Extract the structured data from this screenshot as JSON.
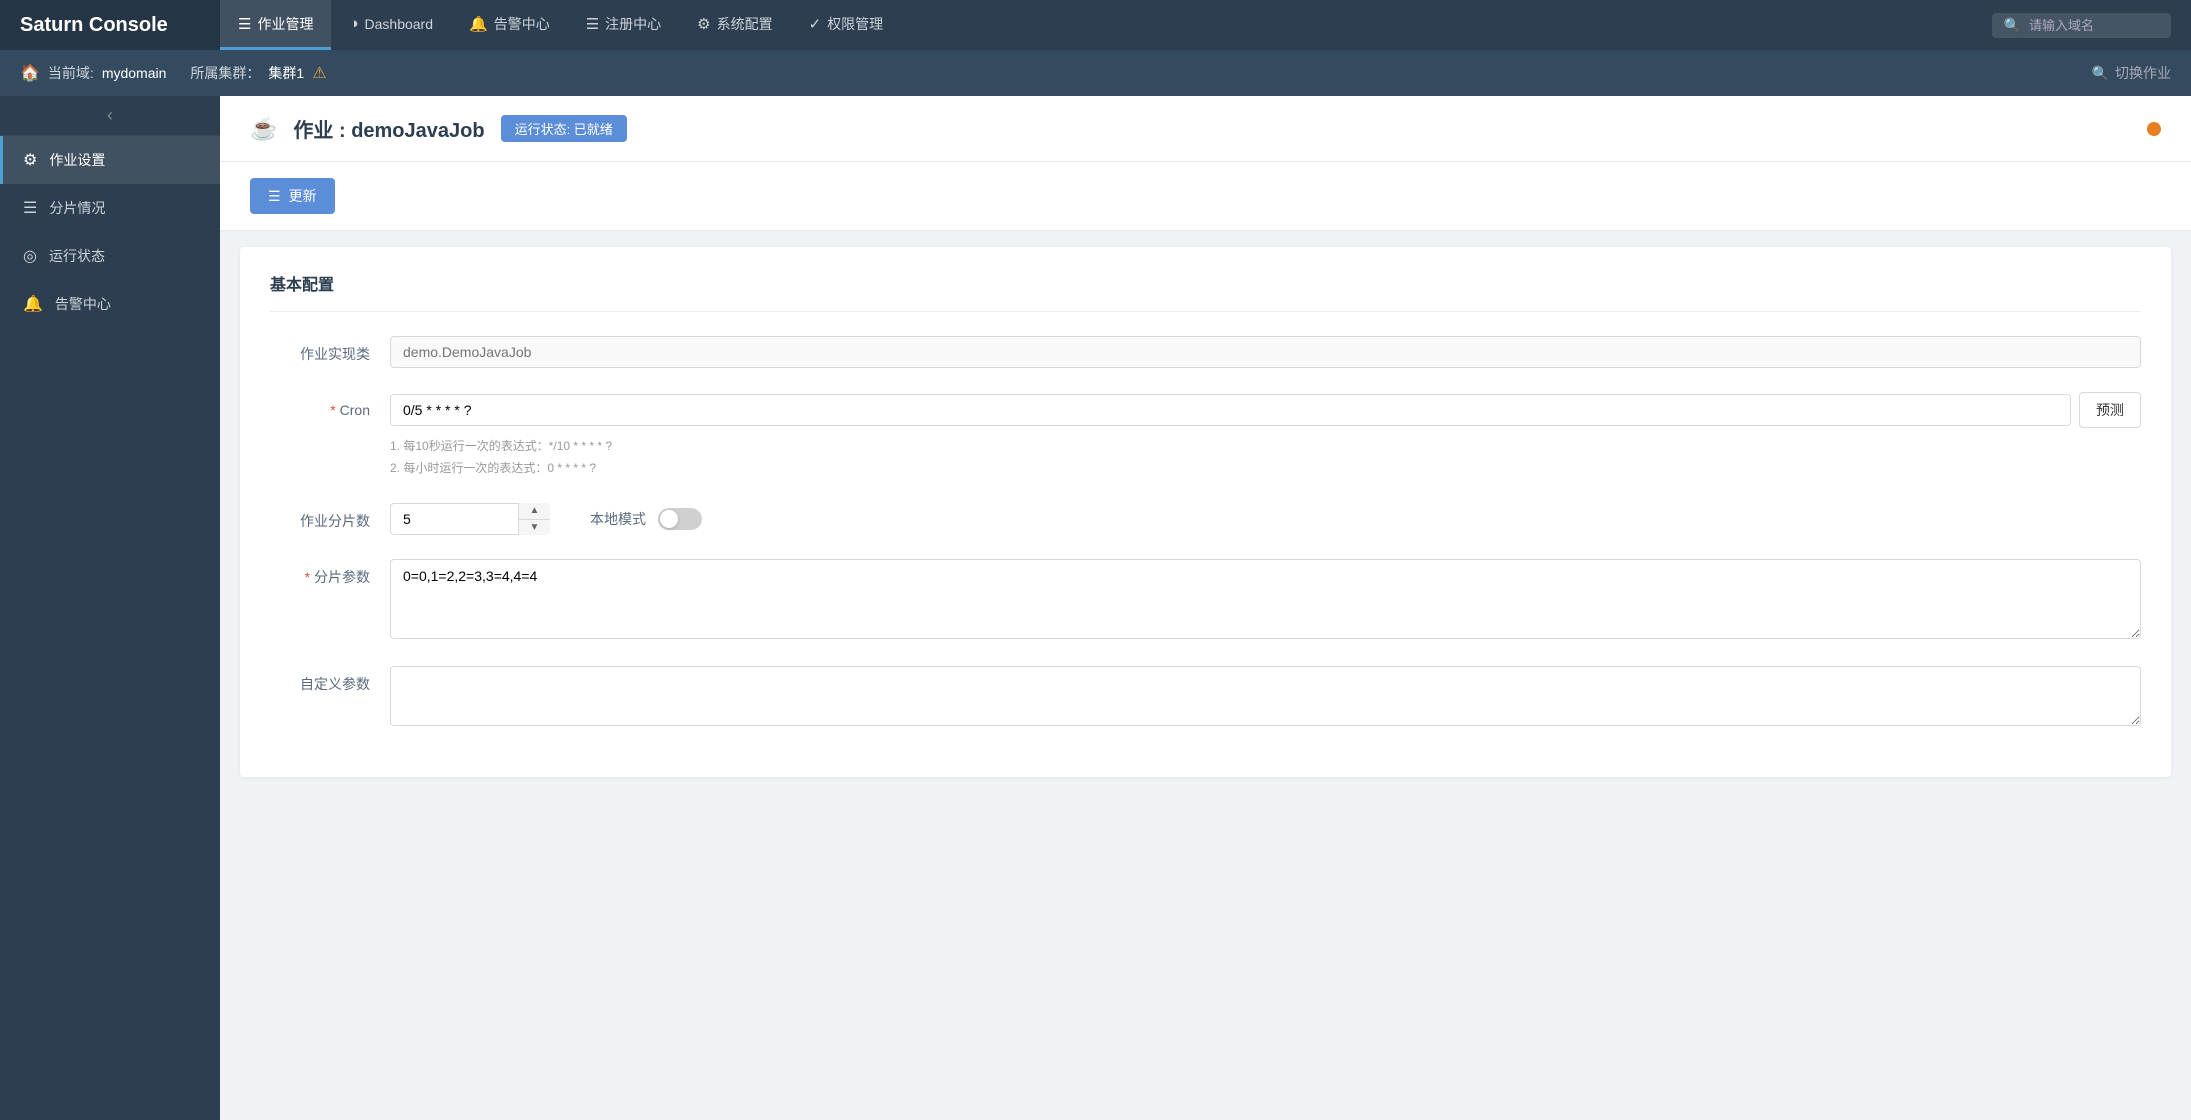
{
  "brand": "Saturn Console",
  "topNav": {
    "tabs": [
      {
        "id": "job-management",
        "icon": "☰",
        "label": "作业管理",
        "active": true
      },
      {
        "id": "dashboard",
        "icon": "◑",
        "label": "Dashboard",
        "active": false
      },
      {
        "id": "alert-center-tab",
        "icon": "🔔",
        "label": "告警中心",
        "active": false
      },
      {
        "id": "registry-center",
        "icon": "☰",
        "label": "注册中心",
        "active": false
      },
      {
        "id": "system-config",
        "icon": "⚙",
        "label": "系统配置",
        "active": false
      },
      {
        "id": "permission-mgmt",
        "icon": "✓",
        "label": "权限管理",
        "active": false
      }
    ],
    "search": {
      "placeholder": "请输入域名",
      "icon": "🔍"
    }
  },
  "subNav": {
    "domain_label": "当前域:",
    "domain_value": "mydomain",
    "cluster_label": "所属集群：",
    "cluster_value": "集群1",
    "switch_job_label": "切换作业",
    "switch_icon": "🔍"
  },
  "sidebar": {
    "collapse_icon": "‹",
    "items": [
      {
        "id": "job-settings",
        "icon": "⚙",
        "label": "作业设置",
        "active": true
      },
      {
        "id": "shard-status",
        "icon": "☰",
        "label": "分片情况",
        "active": false
      },
      {
        "id": "run-status",
        "icon": "◎",
        "label": "运行状态",
        "active": false
      },
      {
        "id": "alert-center",
        "icon": "🔔",
        "label": "告警中心",
        "active": false
      }
    ]
  },
  "pageHeader": {
    "job_icon": "☕",
    "title_prefix": "作业 : ",
    "job_name": "demoJavaJob",
    "status_label": "运行状态: 已就绪",
    "status_color": "#5b8dd9"
  },
  "toolbar": {
    "update_btn_icon": "☰",
    "update_btn_label": "更新"
  },
  "form": {
    "section_title": "基本配置",
    "fields": {
      "job_class": {
        "label": "作业实现类",
        "value": "",
        "placeholder": "demo.DemoJavaJob",
        "required": false
      },
      "cron": {
        "label": "Cron",
        "value": "0/5 * * * * ?",
        "required": true,
        "predict_btn": "预测",
        "hints": [
          "1. 每10秒运行一次的表达式：*/10 * * * * ?",
          "2. 每小时运行一次的表达式：0 * * * * ?"
        ]
      },
      "shards": {
        "label": "作业分片数",
        "value": "5",
        "required": false
      },
      "local_mode": {
        "label": "本地模式",
        "enabled": false
      },
      "shard_params": {
        "label": "分片参数",
        "value": "0=0,1=2,2=3,3=4,4=4",
        "required": true
      },
      "custom_params": {
        "label": "自定义参数",
        "value": "",
        "required": false
      }
    }
  }
}
